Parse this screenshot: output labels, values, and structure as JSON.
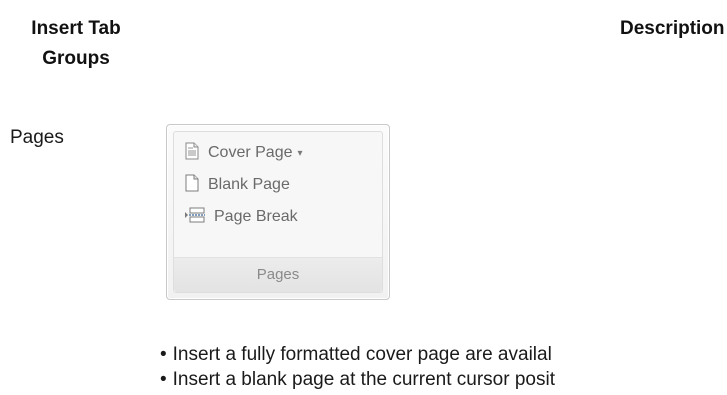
{
  "table_header": {
    "groups": "Insert Tab Groups",
    "description": "Description"
  },
  "row": {
    "label": "Pages",
    "ribbon": {
      "items": [
        {
          "label": "Cover Page",
          "icon": "cover-page-icon",
          "has_dropdown": true
        },
        {
          "label": "Blank Page",
          "icon": "blank-page-icon",
          "has_dropdown": false
        },
        {
          "label": "Page Break",
          "icon": "page-break-icon",
          "has_dropdown": false
        }
      ],
      "group_label": "Pages",
      "dropdown_glyph": "▾"
    },
    "bullets": [
      "Insert a fully formatted cover page are availal",
      "Insert a blank page at the current cursor posit"
    ],
    "bullet_glyph": "•"
  }
}
